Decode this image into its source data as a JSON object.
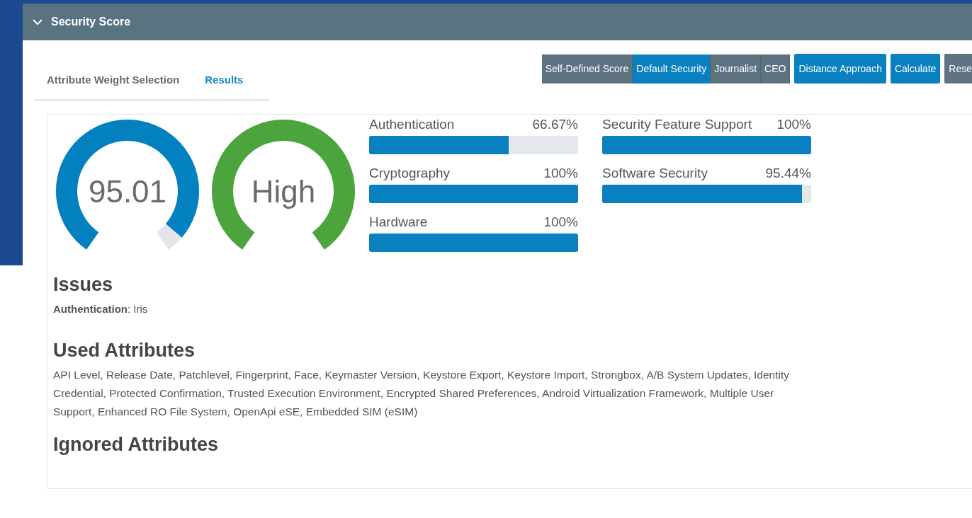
{
  "panel": {
    "title": "Security Score",
    "expanded": true
  },
  "tabs": [
    {
      "label": "Attribute Weight Selection",
      "selected": false
    },
    {
      "label": "Results",
      "selected": true
    }
  ],
  "profile_buttons": [
    {
      "label": "Self-Defined Score",
      "selected": false
    },
    {
      "label": "Default Security",
      "selected": true
    },
    {
      "label": "Journalist",
      "selected": false
    },
    {
      "label": "CEO",
      "selected": false
    }
  ],
  "action_buttons": [
    {
      "label": "Distance Approach",
      "kind": "primary"
    },
    {
      "label": "Calculate",
      "kind": "primary"
    },
    {
      "label": "Rese",
      "kind": "secondary"
    }
  ],
  "gauges": [
    {
      "text": "95.01",
      "level": 0.9501,
      "color": "#0280c0"
    },
    {
      "text": "High",
      "level": 1,
      "color": "#4ca53c"
    }
  ],
  "category_columns": [
    [
      {
        "name": "Authentication",
        "reading": "66.67%",
        "level": 0.6667
      },
      {
        "name": "Cryptography",
        "reading": "100%",
        "level": 1
      },
      {
        "name": "Hardware",
        "reading": "100%",
        "level": 1
      }
    ],
    [
      {
        "name": "Security Feature Support",
        "reading": "100%",
        "level": 1
      },
      {
        "name": "Software Security",
        "reading": "95.44%",
        "level": 0.9544
      }
    ]
  ],
  "sections": [
    {
      "heading": "Issues",
      "text": "**Authentication**: Iris"
    },
    {
      "heading": "Used Attributes",
      "text": "API Level, Release Date, Patchlevel, Fingerprint, Face, Keymaster Version, Keystore Export, Keystore Import, Strongbox, A/B System Updates, Identity Credential, Protected Confirmation, Trusted Execution Environment, Encrypted Shared Preferences, Android Virtualization Framework, Multiple User Support, Enhanced RO File System, OpenApi eSE, Embedded SIM (eSIM)"
    },
    {
      "heading": "Ignored Attributes"
    }
  ]
}
